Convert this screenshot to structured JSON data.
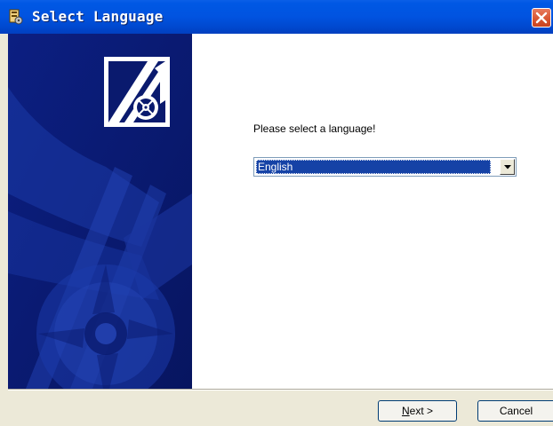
{
  "window": {
    "title": "Select Language"
  },
  "content": {
    "prompt": "Please select a language!",
    "language_select": {
      "selected": "English"
    }
  },
  "buttons": {
    "next_mnemonic": "N",
    "next_rest": "ext >",
    "cancel": "Cancel"
  },
  "icons": {
    "title": "app-icon",
    "close": "close-icon",
    "dropdown": "chevron-down-icon",
    "logo": "music-disc-logo-icon"
  }
}
